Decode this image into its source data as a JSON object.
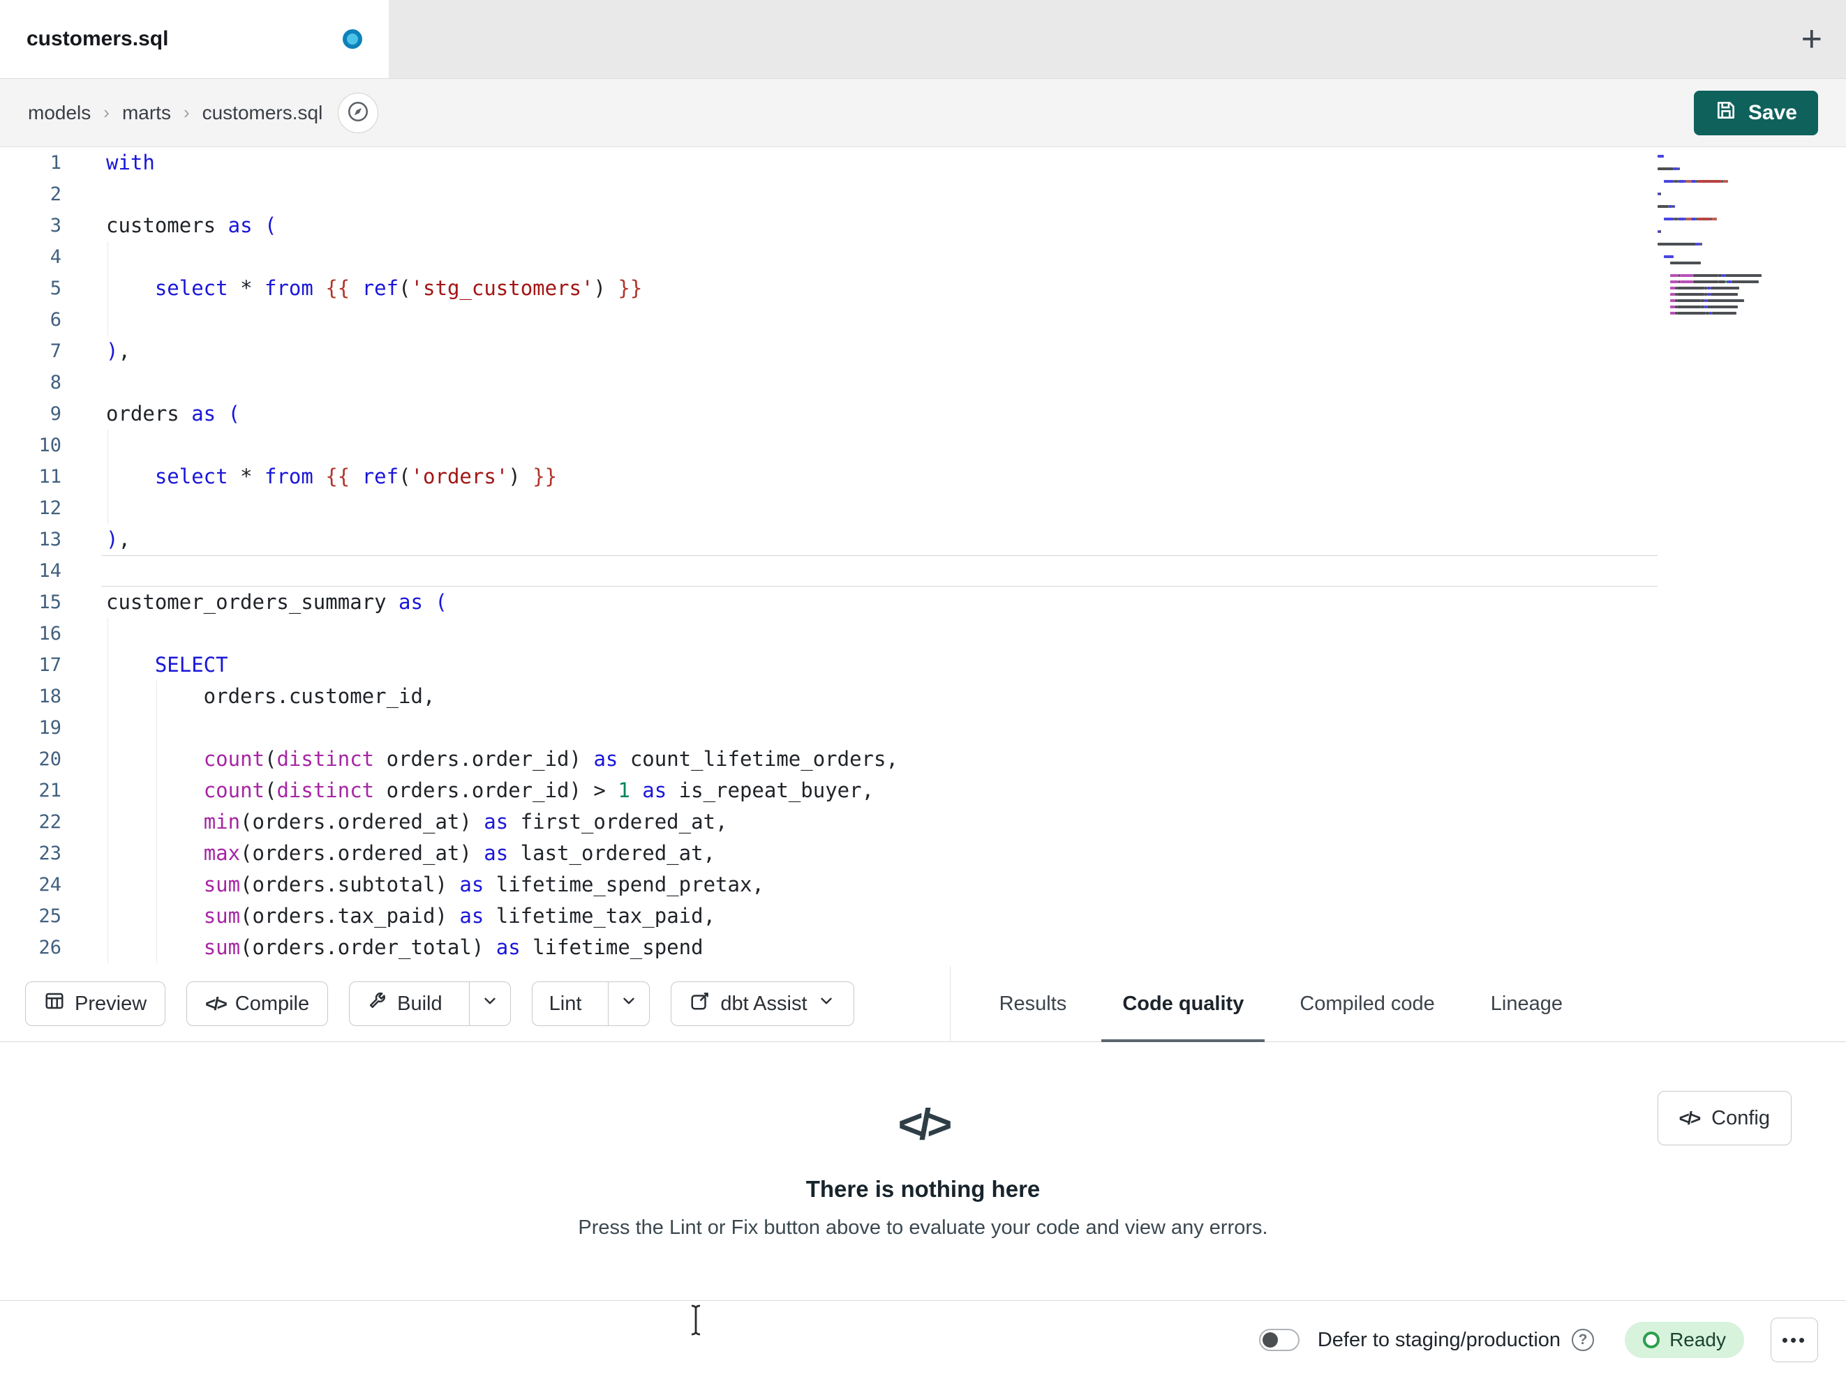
{
  "colors": {
    "save_button": "#0F625C",
    "unsaved_dot": "#0D82BA",
    "ready_bg": "#D8F3DC",
    "ready_text": "#1B4332",
    "active_tab_underline": "#5C6670",
    "syntax": {
      "kw": "#1A16D9",
      "bk": "#1A16D9",
      "str": "#A31515",
      "tpl": "#B1352C",
      "fn": "#A626A4",
      "num": "#098658",
      "pl": "#1F2328",
      "gutter": "#41607F"
    }
  },
  "icons": {
    "code": "</>",
    "plus": "+",
    "more": "•••",
    "help": "?",
    "crumb_sep": "›"
  },
  "tab_bar": {
    "active_tab": "customers.sql"
  },
  "breadcrumb": {
    "items": [
      "models",
      "marts",
      "customers.sql"
    ]
  },
  "actions": {
    "save": "Save"
  },
  "editor": {
    "current_line": 14,
    "lines": [
      {
        "n": 1,
        "seg": [
          [
            "with",
            "kw"
          ]
        ]
      },
      {
        "n": 2,
        "seg": []
      },
      {
        "n": 3,
        "seg": [
          [
            "customers ",
            "pl"
          ],
          [
            "as",
            "kw"
          ],
          [
            " ",
            "pl"
          ],
          [
            "(",
            "bk"
          ]
        ]
      },
      {
        "n": 4,
        "seg": [],
        "g": [
          0
        ]
      },
      {
        "n": 5,
        "seg": [
          [
            "    ",
            "pl"
          ],
          [
            "select",
            "kw"
          ],
          [
            " ",
            "pl"
          ],
          [
            "*",
            "pl"
          ],
          [
            " ",
            "pl"
          ],
          [
            "from",
            "kw"
          ],
          [
            " ",
            "pl"
          ],
          [
            "{{ ",
            "tpl"
          ],
          [
            "ref",
            "kw"
          ],
          [
            "(",
            "pl"
          ],
          [
            "'stg_customers'",
            "str"
          ],
          [
            ")",
            "pl"
          ],
          [
            " }}",
            "tpl"
          ]
        ],
        "g": [
          0
        ]
      },
      {
        "n": 6,
        "seg": [],
        "g": [
          0
        ]
      },
      {
        "n": 7,
        "seg": [
          [
            ")",
            "bk"
          ],
          [
            ",",
            "pl"
          ]
        ]
      },
      {
        "n": 8,
        "seg": []
      },
      {
        "n": 9,
        "seg": [
          [
            "orders ",
            "pl"
          ],
          [
            "as",
            "kw"
          ],
          [
            " ",
            "pl"
          ],
          [
            "(",
            "bk"
          ]
        ]
      },
      {
        "n": 10,
        "seg": [],
        "g": [
          0
        ]
      },
      {
        "n": 11,
        "seg": [
          [
            "    ",
            "pl"
          ],
          [
            "select",
            "kw"
          ],
          [
            " ",
            "pl"
          ],
          [
            "*",
            "pl"
          ],
          [
            " ",
            "pl"
          ],
          [
            "from",
            "kw"
          ],
          [
            " ",
            "pl"
          ],
          [
            "{{ ",
            "tpl"
          ],
          [
            "ref",
            "kw"
          ],
          [
            "(",
            "pl"
          ],
          [
            "'orders'",
            "str"
          ],
          [
            ")",
            "pl"
          ],
          [
            " }}",
            "tpl"
          ]
        ],
        "g": [
          0
        ]
      },
      {
        "n": 12,
        "seg": [],
        "g": [
          0
        ]
      },
      {
        "n": 13,
        "seg": [
          [
            ")",
            "bk"
          ],
          [
            ",",
            "pl"
          ]
        ]
      },
      {
        "n": 14,
        "seg": []
      },
      {
        "n": 15,
        "seg": [
          [
            "customer_orders_summary ",
            "pl"
          ],
          [
            "as",
            "kw"
          ],
          [
            " ",
            "pl"
          ],
          [
            "(",
            "bk"
          ]
        ]
      },
      {
        "n": 16,
        "seg": [],
        "g": [
          0
        ]
      },
      {
        "n": 17,
        "seg": [
          [
            "    ",
            "pl"
          ],
          [
            "SELECT",
            "kw"
          ]
        ],
        "g": [
          0
        ]
      },
      {
        "n": 18,
        "seg": [
          [
            "        orders.customer_id,",
            "pl"
          ]
        ],
        "g": [
          0,
          4
        ]
      },
      {
        "n": 19,
        "seg": [],
        "g": [
          0,
          4
        ]
      },
      {
        "n": 20,
        "seg": [
          [
            "        ",
            "pl"
          ],
          [
            "count",
            "fn"
          ],
          [
            "(",
            "pl"
          ],
          [
            "distinct",
            "fn"
          ],
          [
            " orders.order_id",
            "pl"
          ],
          [
            ") ",
            "pl"
          ],
          [
            "as",
            "kw"
          ],
          [
            " count_lifetime_orders,",
            "pl"
          ]
        ],
        "g": [
          0,
          4
        ]
      },
      {
        "n": 21,
        "seg": [
          [
            "        ",
            "pl"
          ],
          [
            "count",
            "fn"
          ],
          [
            "(",
            "pl"
          ],
          [
            "distinct",
            "fn"
          ],
          [
            " orders.order_id",
            "pl"
          ],
          [
            ") > ",
            "pl"
          ],
          [
            "1",
            "num"
          ],
          [
            " ",
            "pl"
          ],
          [
            "as",
            "kw"
          ],
          [
            " is_repeat_buyer,",
            "pl"
          ]
        ],
        "g": [
          0,
          4
        ]
      },
      {
        "n": 22,
        "seg": [
          [
            "        ",
            "pl"
          ],
          [
            "min",
            "fn"
          ],
          [
            "(",
            "pl"
          ],
          [
            "orders.ordered_at",
            "pl"
          ],
          [
            ") ",
            "pl"
          ],
          [
            "as",
            "kw"
          ],
          [
            " first_ordered_at,",
            "pl"
          ]
        ],
        "g": [
          0,
          4
        ]
      },
      {
        "n": 23,
        "seg": [
          [
            "        ",
            "pl"
          ],
          [
            "max",
            "fn"
          ],
          [
            "(",
            "pl"
          ],
          [
            "orders.ordered_at",
            "pl"
          ],
          [
            ") ",
            "pl"
          ],
          [
            "as",
            "kw"
          ],
          [
            " last_ordered_at,",
            "pl"
          ]
        ],
        "g": [
          0,
          4
        ]
      },
      {
        "n": 24,
        "seg": [
          [
            "        ",
            "pl"
          ],
          [
            "sum",
            "fn"
          ],
          [
            "(",
            "pl"
          ],
          [
            "orders.subtotal",
            "pl"
          ],
          [
            ") ",
            "pl"
          ],
          [
            "as",
            "kw"
          ],
          [
            " lifetime_spend_pretax,",
            "pl"
          ]
        ],
        "g": [
          0,
          4
        ]
      },
      {
        "n": 25,
        "seg": [
          [
            "        ",
            "pl"
          ],
          [
            "sum",
            "fn"
          ],
          [
            "(",
            "pl"
          ],
          [
            "orders.tax_paid",
            "pl"
          ],
          [
            ") ",
            "pl"
          ],
          [
            "as",
            "kw"
          ],
          [
            " lifetime_tax_paid,",
            "pl"
          ]
        ],
        "g": [
          0,
          4
        ]
      },
      {
        "n": 26,
        "seg": [
          [
            "        ",
            "pl"
          ],
          [
            "sum",
            "fn"
          ],
          [
            "(",
            "pl"
          ],
          [
            "orders.order_total",
            "pl"
          ],
          [
            ") ",
            "pl"
          ],
          [
            "as",
            "kw"
          ],
          [
            " lifetime_spend",
            "pl"
          ]
        ],
        "g": [
          0,
          4
        ]
      }
    ]
  },
  "toolbar": {
    "preview": "Preview",
    "compile": "Compile",
    "build": "Build",
    "lint": "Lint",
    "assist": "dbt Assist"
  },
  "panel_tabs": {
    "items": [
      {
        "label": "Results",
        "active": false
      },
      {
        "label": "Code quality",
        "active": true
      },
      {
        "label": "Compiled code",
        "active": false
      },
      {
        "label": "Lineage",
        "active": false
      }
    ]
  },
  "results_panel": {
    "title": "There is nothing here",
    "subtitle": "Press the Lint or Fix button above to evaluate your code and view any errors.",
    "config": "Config"
  },
  "status_bar": {
    "defer_label": "Defer to staging/production",
    "ready": "Ready"
  }
}
